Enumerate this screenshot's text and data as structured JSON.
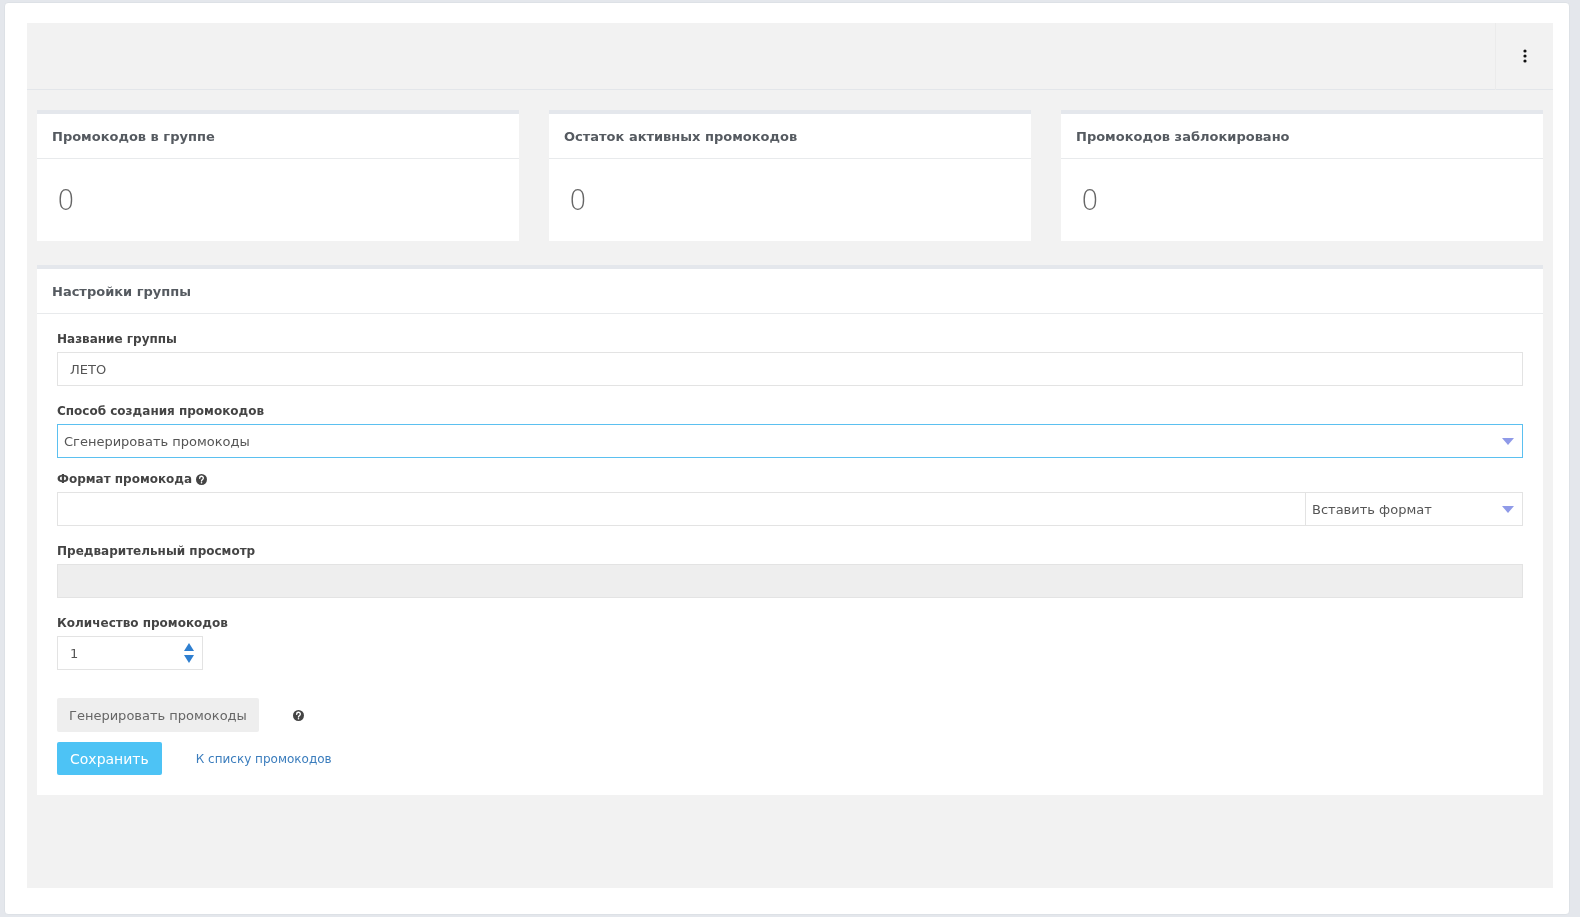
{
  "stats": [
    {
      "title": "Промокодов в группе",
      "value": "0"
    },
    {
      "title": "Остаток активных промокодов",
      "value": "0"
    },
    {
      "title": "Промокодов заблокировано",
      "value": "0"
    }
  ],
  "settings": {
    "title": "Настройки группы",
    "name_field": {
      "label": "Название группы",
      "value": "ЛЕТО"
    },
    "method_field": {
      "label": "Способ создания промокодов",
      "value": "Сгенерировать промокоды",
      "focused": true
    },
    "format_field": {
      "label": "Формат промокода",
      "insert_select": "Вставить формат"
    },
    "preview_field": {
      "label": "Предварительный просмотр",
      "disabled": true
    },
    "count_field": {
      "label": "Количество промокодов",
      "value": "1"
    },
    "generate_button": "Генерировать промокоды",
    "save_button": "Сохранить",
    "back_link": "К списку промокодов"
  }
}
